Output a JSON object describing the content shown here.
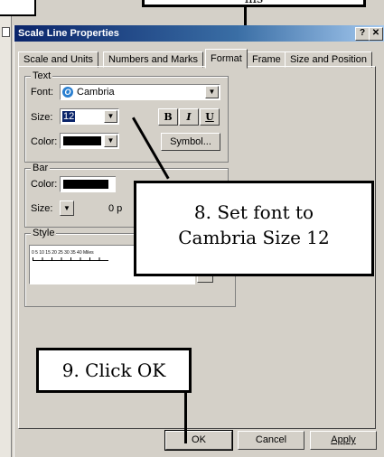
{
  "callout_top": {
    "text": "ms"
  },
  "dialog": {
    "title": "Scale Line Properties",
    "help_btn": "?",
    "close_btn": "✕"
  },
  "tabs": [
    "Scale and Units",
    "Numbers and Marks",
    "Format",
    "Frame",
    "Size and Position"
  ],
  "text_group": {
    "legend": "Text",
    "font_label": "Font:",
    "font_value": "Cambria",
    "size_label": "Size:",
    "size_value": "12",
    "color_label": "Color:",
    "bold": "B",
    "italic": "I",
    "underline": "U",
    "symbol_btn": "Symbol..."
  },
  "bar_group": {
    "legend": "Bar",
    "color_label": "Color:",
    "size_label": "Size:",
    "size_value": "0 p"
  },
  "style_group": {
    "legend": "Style",
    "preview_text": "0 5 10 15 20 25 30 35 40 Miles",
    "props_icon": "i"
  },
  "callout_font": {
    "line1": "8. Set font to",
    "line2": "Cambria Size 12"
  },
  "callout_ok": {
    "text": "9. Click OK"
  },
  "buttons": {
    "ok": "OK",
    "cancel": "Cancel",
    "apply": "Apply"
  },
  "colors": {
    "text_color": "#000000",
    "bar_color": "#000000",
    "title_start": "#0a246a"
  }
}
